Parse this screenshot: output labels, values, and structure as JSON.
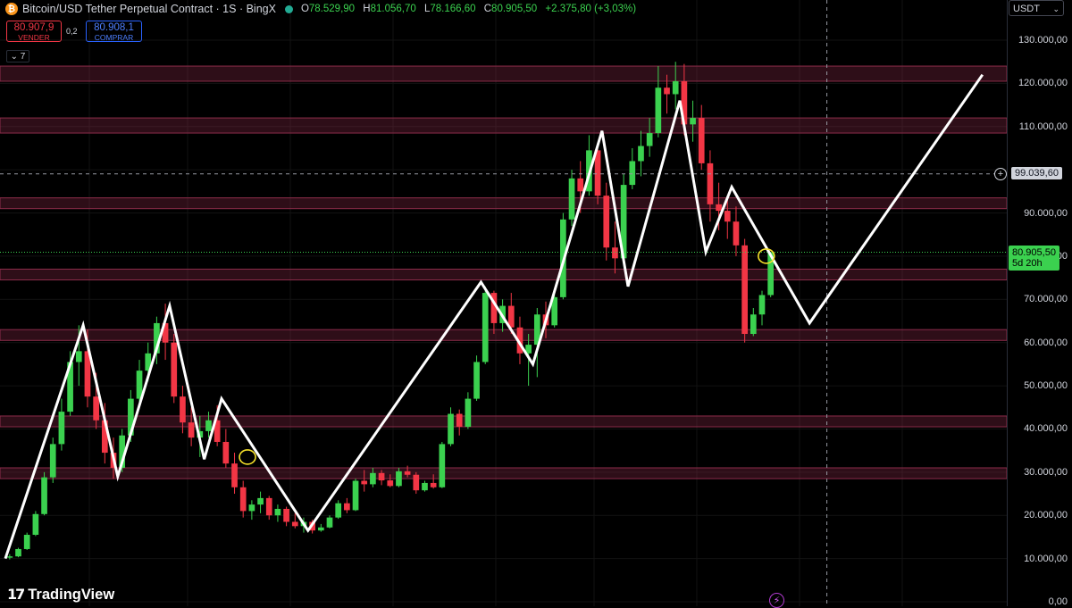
{
  "header": {
    "title": "Bitcoin/USD Tether Perpetual Contract · 1S · BingX",
    "ohlc": {
      "o_label": "O",
      "o_value": "78.529,90",
      "h_label": "H",
      "h_value": "81.056,70",
      "l_label": "L",
      "l_value": "78.166,60",
      "c_label": "C",
      "c_value": "80.905,50",
      "change": "+2.375,80 (+3,03%)"
    },
    "icon": "bitcoin-icon",
    "status_dot": "market-open-icon"
  },
  "trade": {
    "sell_price": "80.907,9",
    "sell_label": "VENDER",
    "spread": "0,2",
    "buy_price": "80.908,1",
    "buy_label": "COMPRAR"
  },
  "indicator_toggle": "7",
  "axis": {
    "currency": "USDT",
    "ticks": [
      "130.000,00",
      "120.000,00",
      "110.000,00",
      "90.000,00",
      "80.000,00",
      "70.000,00",
      "60.000,00",
      "50.000,00",
      "40.000,00",
      "30.000,00",
      "20.000,00",
      "10.000,00",
      "0,00"
    ],
    "crosshair_label": "99.039,60",
    "last_price": "80.905,50",
    "countdown": "5d 20h"
  },
  "logo": "TradingView",
  "colors": {
    "up": "#3bd14f",
    "down": "#f23645",
    "zone": "#8c2c4a",
    "projection": "#ffffff",
    "marker": "#f5e02a"
  },
  "chart_data": {
    "type": "candlestick",
    "symbol": "BTCUSDT.P",
    "interval": "1S",
    "ylim": [
      0,
      135000
    ],
    "support_resistance_zones": [
      [
        120500,
        124000
      ],
      [
        108500,
        112000
      ],
      [
        91000,
        93500
      ],
      [
        74500,
        77000
      ],
      [
        60500,
        63000
      ],
      [
        40500,
        43000
      ],
      [
        28500,
        31000
      ]
    ],
    "projection_path": [
      {
        "bar": 0,
        "y": 10000
      },
      {
        "bar": 9,
        "y": 64000
      },
      {
        "bar": 13,
        "y": 29000
      },
      {
        "bar": 19,
        "y": 68500
      },
      {
        "bar": 23,
        "y": 33000
      },
      {
        "bar": 25,
        "y": 47000
      },
      {
        "bar": 35,
        "y": 16500
      },
      {
        "bar": 55,
        "y": 74000
      },
      {
        "bar": 61,
        "y": 55000
      },
      {
        "bar": 69,
        "y": 109000
      },
      {
        "bar": 72,
        "y": 73000
      },
      {
        "bar": 78,
        "y": 116000
      },
      {
        "bar": 81,
        "y": 81000
      },
      {
        "bar": 84,
        "y": 96000
      },
      {
        "bar": 93,
        "y": 64500
      },
      {
        "bar": 113,
        "y": 122000
      }
    ],
    "markers": [
      {
        "bar": 28,
        "y": 33500
      },
      {
        "bar": 88,
        "y": 80000
      }
    ],
    "last_price": 80905.5,
    "crosshair_y": 99039.6,
    "crosshair_bar": 95,
    "candles_ohlc": [
      [
        10200,
        11000,
        9800,
        10500
      ],
      [
        10500,
        12500,
        10300,
        12200
      ],
      [
        12200,
        16000,
        12000,
        15500
      ],
      [
        15500,
        21000,
        15200,
        20300
      ],
      [
        20300,
        30000,
        20000,
        28800
      ],
      [
        28800,
        38000,
        27500,
        36500
      ],
      [
        36500,
        47000,
        35000,
        44000
      ],
      [
        44000,
        58000,
        43000,
        55500
      ],
      [
        55500,
        64000,
        50000,
        58000
      ],
      [
        58000,
        63000,
        45000,
        47500
      ],
      [
        47500,
        53000,
        40000,
        42000
      ],
      [
        42000,
        46000,
        32000,
        34500
      ],
      [
        34500,
        38000,
        28500,
        31000
      ],
      [
        31000,
        40000,
        30000,
        38500
      ],
      [
        38500,
        49000,
        37000,
        47000
      ],
      [
        47000,
        56000,
        45000,
        53500
      ],
      [
        53500,
        60000,
        51000,
        57500
      ],
      [
        57500,
        66000,
        55000,
        64500
      ],
      [
        64500,
        69000,
        56000,
        60000
      ],
      [
        60000,
        62000,
        46000,
        47500
      ],
      [
        47500,
        50000,
        39000,
        41500
      ],
      [
        41500,
        45000,
        36000,
        38000
      ],
      [
        38000,
        43000,
        33500,
        39500
      ],
      [
        39500,
        44000,
        38000,
        42000
      ],
      [
        42000,
        45500,
        36000,
        37000
      ],
      [
        37000,
        40000,
        31000,
        32000
      ],
      [
        32000,
        34500,
        25000,
        26500
      ],
      [
        26500,
        28000,
        19500,
        21000
      ],
      [
        21000,
        23500,
        19000,
        22500
      ],
      [
        22500,
        25500,
        20500,
        24000
      ],
      [
        24000,
        24500,
        19000,
        20000
      ],
      [
        20000,
        22500,
        18500,
        21500
      ],
      [
        21500,
        22000,
        17500,
        18500
      ],
      [
        18500,
        20500,
        17000,
        17500
      ],
      [
        17500,
        19500,
        16000,
        18500
      ],
      [
        18500,
        19000,
        15800,
        16500
      ],
      [
        16500,
        18000,
        16200,
        17200
      ],
      [
        17200,
        20000,
        17000,
        19500
      ],
      [
        19500,
        23500,
        19200,
        22800
      ],
      [
        22800,
        24000,
        20500,
        21200
      ],
      [
        21200,
        28500,
        21000,
        28000
      ],
      [
        28000,
        30500,
        25500,
        27200
      ],
      [
        27200,
        31000,
        26500,
        29800
      ],
      [
        29800,
        30500,
        27000,
        28100
      ],
      [
        28100,
        29500,
        26500,
        26800
      ],
      [
        26800,
        31000,
        26500,
        30200
      ],
      [
        30200,
        31500,
        28800,
        29400
      ],
      [
        29400,
        30000,
        25000,
        25800
      ],
      [
        25800,
        28000,
        25500,
        27500
      ],
      [
        27500,
        29500,
        26200,
        26500
      ],
      [
        26500,
        37000,
        26300,
        36500
      ],
      [
        36500,
        45000,
        36000,
        43500
      ],
      [
        43500,
        44500,
        38500,
        40500
      ],
      [
        40500,
        48500,
        40000,
        47000
      ],
      [
        47000,
        57000,
        46500,
        55500
      ],
      [
        55500,
        73000,
        55000,
        71500
      ],
      [
        71500,
        72000,
        62000,
        64500
      ],
      [
        64500,
        70000,
        62500,
        68500
      ],
      [
        68500,
        71500,
        62000,
        63500
      ],
      [
        63500,
        66000,
        55000,
        57500
      ],
      [
        57500,
        62000,
        50000,
        59500
      ],
      [
        59500,
        68000,
        52000,
        66500
      ],
      [
        66500,
        69500,
        61000,
        64000
      ],
      [
        64000,
        72000,
        63500,
        70500
      ],
      [
        70500,
        90000,
        70000,
        88500
      ],
      [
        88500,
        100000,
        87000,
        98000
      ],
      [
        98000,
        102000,
        90000,
        95000
      ],
      [
        95000,
        108000,
        94000,
        104500
      ],
      [
        104500,
        106000,
        92000,
        94000
      ],
      [
        94000,
        97000,
        79000,
        82000
      ],
      [
        82000,
        88000,
        76000,
        79500
      ],
      [
        79500,
        99000,
        79000,
        96500
      ],
      [
        96500,
        105000,
        95500,
        102000
      ],
      [
        102000,
        109000,
        98500,
        105500
      ],
      [
        105500,
        112000,
        103000,
        108500
      ],
      [
        108500,
        124000,
        107500,
        119000
      ],
      [
        119000,
        122000,
        113000,
        117500
      ],
      [
        117500,
        125000,
        114000,
        120500
      ],
      [
        120500,
        124500,
        108000,
        110500
      ],
      [
        110500,
        116000,
        106500,
        112000
      ],
      [
        112000,
        115000,
        100000,
        101500
      ],
      [
        101500,
        104500,
        88000,
        92000
      ],
      [
        92000,
        97000,
        86000,
        90500
      ],
      [
        90500,
        94000,
        84000,
        88000
      ],
      [
        88000,
        91500,
        80000,
        82500
      ],
      [
        82500,
        84000,
        60000,
        62000
      ],
      [
        62000,
        68000,
        61500,
        66500
      ],
      [
        66500,
        72000,
        64000,
        71000
      ],
      [
        71000,
        81000,
        70500,
        80905.5
      ]
    ]
  }
}
